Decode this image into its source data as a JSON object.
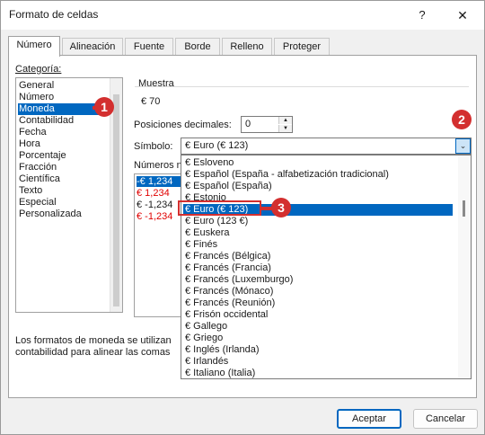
{
  "window": {
    "title": "Formato de celdas",
    "help_label": "?",
    "close_label": "✕"
  },
  "tabs": [
    "Número",
    "Alineación",
    "Fuente",
    "Borde",
    "Relleno",
    "Proteger"
  ],
  "categories": {
    "label": "Categoría:",
    "items": [
      "General",
      "Número",
      "Moneda",
      "Contabilidad",
      "Fecha",
      "Hora",
      "Porcentaje",
      "Fracción",
      "Científica",
      "Texto",
      "Especial",
      "Personalizada"
    ],
    "selected": "Moneda"
  },
  "sample": {
    "label": "Muestra",
    "value": "€ 70"
  },
  "decimals": {
    "label": "Posiciones decimales:",
    "value": "0"
  },
  "symbol": {
    "label": "Símbolo:",
    "value": "€ Euro (€ 123)"
  },
  "negatives": {
    "label": "Números n",
    "items": [
      {
        "text": "-€ 1,234",
        "color": "#ffffff",
        "selected": true
      },
      {
        "text": "€ 1,234",
        "color": "#e00000",
        "selected": false
      },
      {
        "text": "€ -1,234",
        "color": "#1a1a1a",
        "selected": false
      },
      {
        "text": "€ -1,234",
        "color": "#e00000",
        "selected": false
      }
    ]
  },
  "dropdown": {
    "items": [
      "€ Esloveno",
      "€ Español (España - alfabetización tradicional)",
      "€ Español (España)",
      "€ Estonio",
      "€ Euro (€ 123)",
      "€ Euro (123 €)",
      "€ Euskera",
      "€ Finés",
      "€ Francés (Bélgica)",
      "€ Francés (Francia)",
      "€ Francés (Luxemburgo)",
      "€ Francés (Mónaco)",
      "€ Francés (Reunión)",
      "€ Frisón occidental",
      "€ Gallego",
      "€ Griego",
      "€ Inglés (Irlanda)",
      "€ Irlandés",
      "€ Italiano (Italia)"
    ],
    "selected": "€ Euro (€ 123)"
  },
  "description": {
    "line1": "Los formatos de moneda se utilizan",
    "line2": "contabilidad para alinear las comas"
  },
  "buttons": {
    "ok": "Aceptar",
    "cancel": "Cancelar"
  },
  "callouts": [
    "1",
    "2",
    "3"
  ],
  "colors": {
    "accent": "#0067c0",
    "callout": "#d32f2f",
    "negative": "#e00000"
  }
}
